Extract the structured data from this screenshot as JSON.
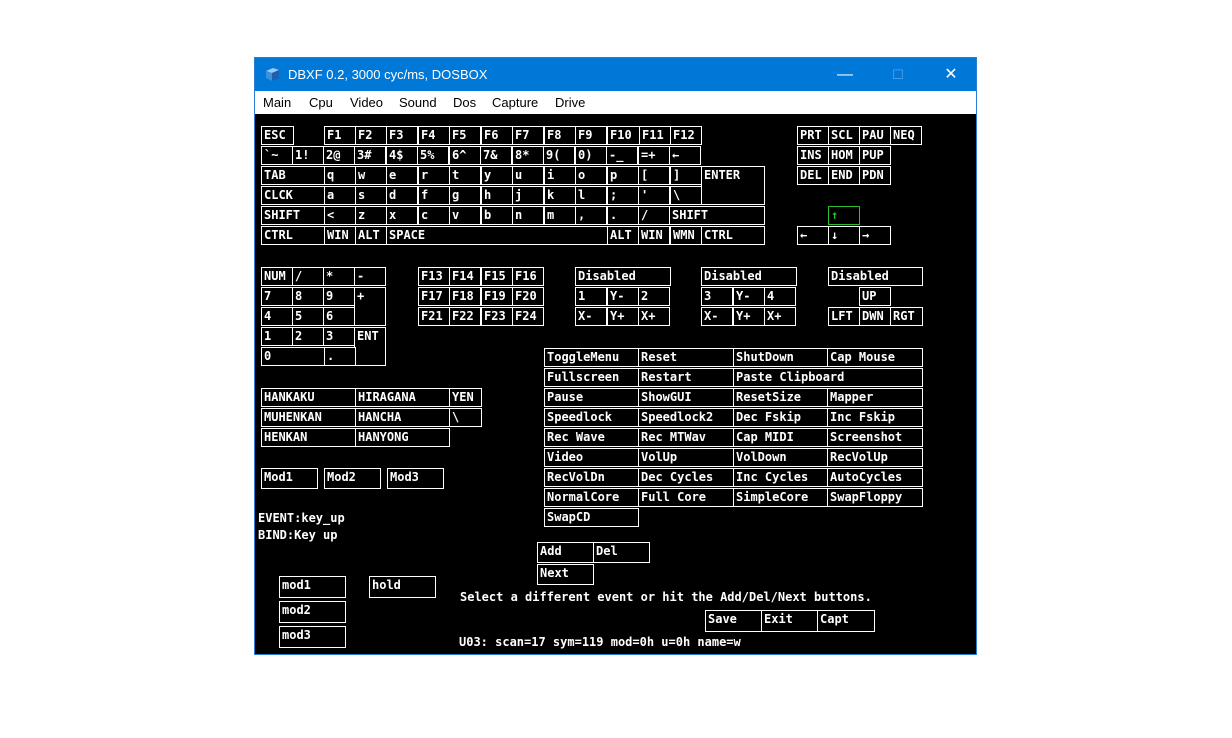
{
  "window": {
    "title": "DBXF 0.2, 3000 cyc/ms, DOSBOX",
    "controls": {
      "minimize": "—",
      "maximize": "☐",
      "close": "✕"
    }
  },
  "menu": [
    "Main",
    "Cpu",
    "Video",
    "Sound",
    "Dos",
    "Capture",
    "Drive"
  ],
  "keys": {
    "esc": "ESC",
    "f1": "F1",
    "f2": "F2",
    "f3": "F3",
    "f4": "F4",
    "f5": "F5",
    "f6": "F6",
    "f7": "F7",
    "f8": "F8",
    "f9": "F9",
    "f10": "F10",
    "f11": "F11",
    "f12": "F12",
    "prt": "PRT",
    "scl": "SCL",
    "pau": "PAU",
    "neq": "NEQ",
    "grave": "`~",
    "n1": "1!",
    "n2": "2@",
    "n3": "3#",
    "n4": "4$",
    "n5": "5%",
    "n6": "6^",
    "n7": "7&",
    "n8": "8*",
    "n9": "9(",
    "n0": "0)",
    "minus": "-_",
    "equals": "=+",
    "bksp": "←",
    "ins": "INS",
    "hom": "HOM",
    "pup": "PUP",
    "tab": "TAB",
    "q": "q",
    "w": "w",
    "e": "e",
    "r": "r",
    "t": "t",
    "y": "y",
    "u": "u",
    "i": "i",
    "o": "o",
    "p": "p",
    "lbr": "[",
    "rbr": "]",
    "enter": "ENTER",
    "del": "DEL",
    "end": "END",
    "pdn": "PDN",
    "clck": "CLCK",
    "a": "a",
    "s": "s",
    "d": "d",
    "f": "f",
    "g": "g",
    "h": "h",
    "j": "j",
    "k": "k",
    "l": "l",
    "semi": ";",
    "quote": "'",
    "bslash": "\\",
    "lshift": "SHIFT",
    "lt": "<",
    "z": "z",
    "x": "x",
    "c": "c",
    "v": "v",
    "b": "b",
    "n": "n",
    "m": "m",
    "comma": ",",
    "period": ".",
    "slash": "/",
    "rshift": "SHIFT",
    "up": "↑",
    "lctrl": "CTRL",
    "win": "WIN",
    "alt": "ALT",
    "space": "SPACE",
    "ralt": "ALT",
    "rwin": "WIN",
    "wmn": "WMN",
    "rctrl": "CTRL",
    "left": "←",
    "down": "↓",
    "right": "→"
  },
  "numpad": {
    "num": "NUM",
    "div": "/",
    "mul": "*",
    "sub": "-",
    "n7": "7",
    "n8": "8",
    "n9": "9",
    "add": "+",
    "n4": "4",
    "n5": "5",
    "n6": "6",
    "n1": "1",
    "n2": "2",
    "n3": "3",
    "ent": "ENT",
    "n0": "0",
    "dot": "."
  },
  "fkeys_ext": [
    "F13",
    "F14",
    "F15",
    "F16",
    "F17",
    "F18",
    "F19",
    "F20",
    "F21",
    "F22",
    "F23",
    "F24"
  ],
  "joy1": {
    "header": "Disabled",
    "b1": "1",
    "yminus": "Y-",
    "b2": "2",
    "xminus": "X-",
    "yplus": "Y+",
    "xplus": "X+"
  },
  "joy2": {
    "header": "Disabled",
    "b3": "3",
    "yminus": "Y-",
    "b4": "4",
    "xminus": "X-",
    "yplus": "Y+",
    "xplus": "X+"
  },
  "hat": {
    "header": "Disabled",
    "up": "UP",
    "left": "LFT",
    "down": "DWN",
    "right": "RGT"
  },
  "events": [
    "ToggleMenu",
    "Reset",
    "ShutDown",
    "Cap Mouse",
    "Fullscreen",
    "Restart",
    "Paste Clipboard",
    "Pause",
    "ShowGUI",
    "ResetSize",
    "Mapper",
    "Speedlock",
    "Speedlock2",
    "Dec Fskip",
    "Inc Fskip",
    "Rec Wave",
    "Rec MTWav",
    "Cap MIDI",
    "Screenshot",
    "Video",
    "VolUp",
    "VolDown",
    "RecVolUp",
    "RecVolDn",
    "Dec Cycles",
    "Inc Cycles",
    "AutoCycles",
    "NormalCore",
    "Full Core",
    "SimpleCore",
    "SwapFloppy",
    "SwapCD"
  ],
  "jp": {
    "hankaku": "HANKAKU",
    "hiragana": "HIRAGANA",
    "yen": "YEN",
    "muhenkan": "MUHENKAN",
    "hancha": "HANCHA",
    "bslash": "\\",
    "henkan": "HENKAN",
    "hanyong": "HANYONG"
  },
  "mods": {
    "mod1": "Mod1",
    "mod2": "Mod2",
    "mod3": "Mod3"
  },
  "status": {
    "event": "EVENT:key_up",
    "bind": "BIND:Key up",
    "hint": "Select a different event or hit the Add/Del/Next buttons.",
    "info": "U03: scan=17 sym=119 mod=0h u=0h name=w"
  },
  "actions": {
    "add": "Add",
    "del": "Del",
    "next": "Next",
    "save": "Save",
    "exit": "Exit",
    "capt": "Capt"
  },
  "bind_opts": {
    "mod1": "mod1",
    "mod2": "mod2",
    "mod3": "mod3",
    "hold": "hold"
  },
  "colors": {
    "titlebar": "#0078d7",
    "screen_bg": "#000000",
    "key_border": "#ffffff",
    "highlight": "#2ebd2e"
  }
}
